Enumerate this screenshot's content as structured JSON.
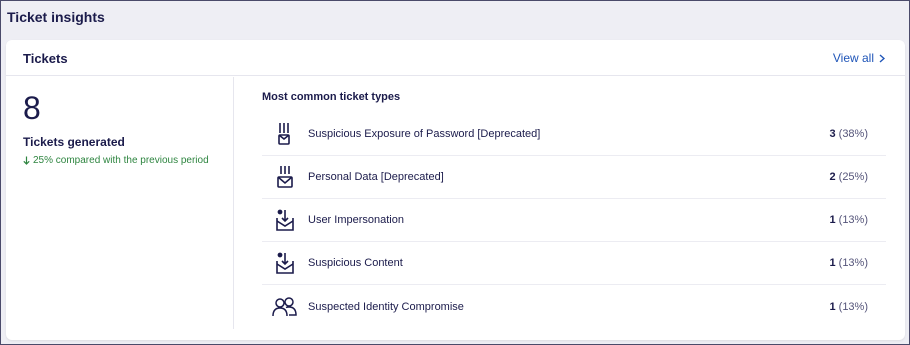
{
  "section": {
    "title": "Ticket insights"
  },
  "card": {
    "title": "Tickets",
    "view_all": "View all"
  },
  "summary": {
    "count": "8",
    "label": "Tickets generated",
    "change": "25% compared with the previous period",
    "change_direction": "down",
    "change_color": "#2e8540"
  },
  "types": {
    "title": "Most common ticket types",
    "items": [
      {
        "label": "Suspicious Exposure of Password [Deprecated]",
        "count": "3",
        "pct": "(38%)",
        "icon": "password-exposure-icon"
      },
      {
        "label": "Personal Data [Deprecated]",
        "count": "2",
        "pct": "(25%)",
        "icon": "personal-data-icon"
      },
      {
        "label": "User Impersonation",
        "count": "1",
        "pct": "(13%)",
        "icon": "mail-inbox-icon"
      },
      {
        "label": "Suspicious Content",
        "count": "1",
        "pct": "(13%)",
        "icon": "mail-inbox-icon"
      },
      {
        "label": "Suspected Identity Compromise",
        "count": "1",
        "pct": "(13%)",
        "icon": "users-icon"
      }
    ]
  }
}
